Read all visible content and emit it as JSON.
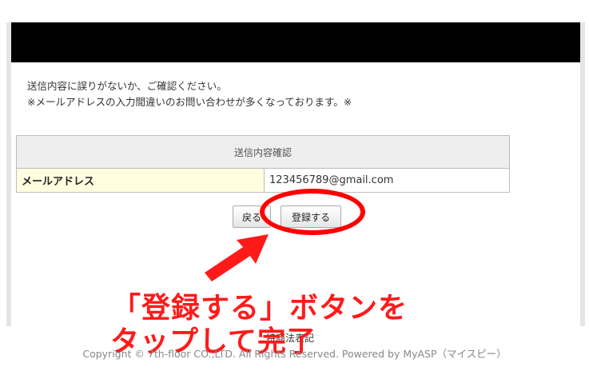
{
  "notice": {
    "line1": "送信内容に誤りがないか、ご確認ください。",
    "line2": "※メールアドレスの入力間違いのお問い合わせが多くなっております。※"
  },
  "table": {
    "header": "送信内容確認",
    "rows": [
      {
        "label": "メールアドレス",
        "value": "123456789@gmail.com"
      }
    ]
  },
  "buttons": {
    "back": "戻る",
    "submit": "登録する"
  },
  "annotation": {
    "line1": "「登録する」ボタンを",
    "line2": "タップして完了",
    "color": "#ff1a1a"
  },
  "footer": {
    "legal": "特商法表記",
    "copyright": "Copyright © 7th-floor CO.,LTD. All Rights Reserved. Powered by MyASP（マイスピー）"
  }
}
